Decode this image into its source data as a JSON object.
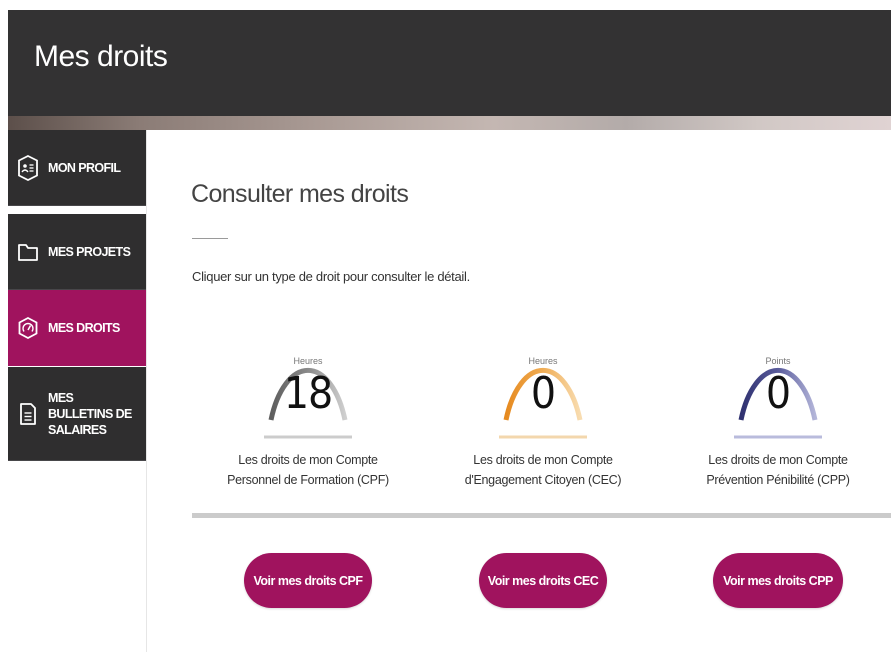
{
  "header": {
    "title": "Mes droits"
  },
  "sidebar": {
    "items": [
      {
        "label": "MON PROFIL",
        "icon": "profile-card-icon",
        "active": false
      },
      {
        "label": "MES PROJETS",
        "icon": "folder-icon",
        "active": false
      },
      {
        "label": "MES DROITS",
        "icon": "gauge-icon",
        "active": true
      },
      {
        "label": "MES BULLETINS DE SALAIRES",
        "icon": "document-icon",
        "active": false
      }
    ]
  },
  "main": {
    "title": "Consulter mes droits",
    "instruction": "Cliquer sur un type de droit pour consulter le détail.",
    "gauges": [
      {
        "unit": "Heures",
        "value": "18",
        "caption_line1": "Les droits de mon Compte",
        "caption_line2": "Personnel de Formation (CPF)",
        "color": "#6b6b6b",
        "color_light": "#c9c9c9"
      },
      {
        "unit": "Heures",
        "value": "0",
        "caption_line1": "Les droits de mon Compte",
        "caption_line2": "d'Engagement Citoyen (CEC)",
        "color": "#e8942d",
        "color_light": "#f6d6a6"
      },
      {
        "unit": "Points",
        "value": "0",
        "caption_line1": "Les droits de mon Compte",
        "caption_line2": "Prévention Pénibilité (CPP)",
        "color": "#3a3c7d",
        "color_light": "#a7a9d0"
      }
    ],
    "buttons": [
      {
        "label": "Voir mes droits CPF"
      },
      {
        "label": "Voir mes droits CEC"
      },
      {
        "label": "Voir mes droits CPP"
      }
    ]
  },
  "colors": {
    "header_bg": "#333233",
    "sidebar_bg": "#2f2e2f",
    "accent": "#a0135e",
    "separator": "#cbcbcb"
  }
}
